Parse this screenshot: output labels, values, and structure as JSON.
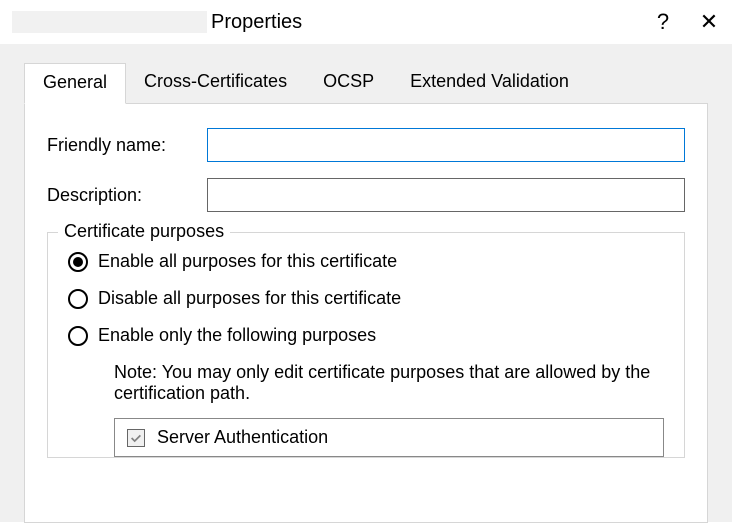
{
  "titlebar": {
    "title_suffix": "Properties",
    "help": "?",
    "close": "✕"
  },
  "tabs": {
    "general": "General",
    "cross": "Cross-Certificates",
    "ocsp": "OCSP",
    "ev": "Extended Validation"
  },
  "friendly": {
    "label": "Friendly name:",
    "value": ""
  },
  "description": {
    "label": "Description:",
    "value": ""
  },
  "purposes": {
    "legend": "Certificate purposes",
    "enable_all": "Enable all purposes for this certificate",
    "disable_all": "Disable all purposes for this certificate",
    "enable_only": "Enable only the following purposes",
    "note": "Note: You may only edit certificate purposes that are allowed by the certification path.",
    "items": {
      "server_auth": "Server Authentication"
    }
  }
}
